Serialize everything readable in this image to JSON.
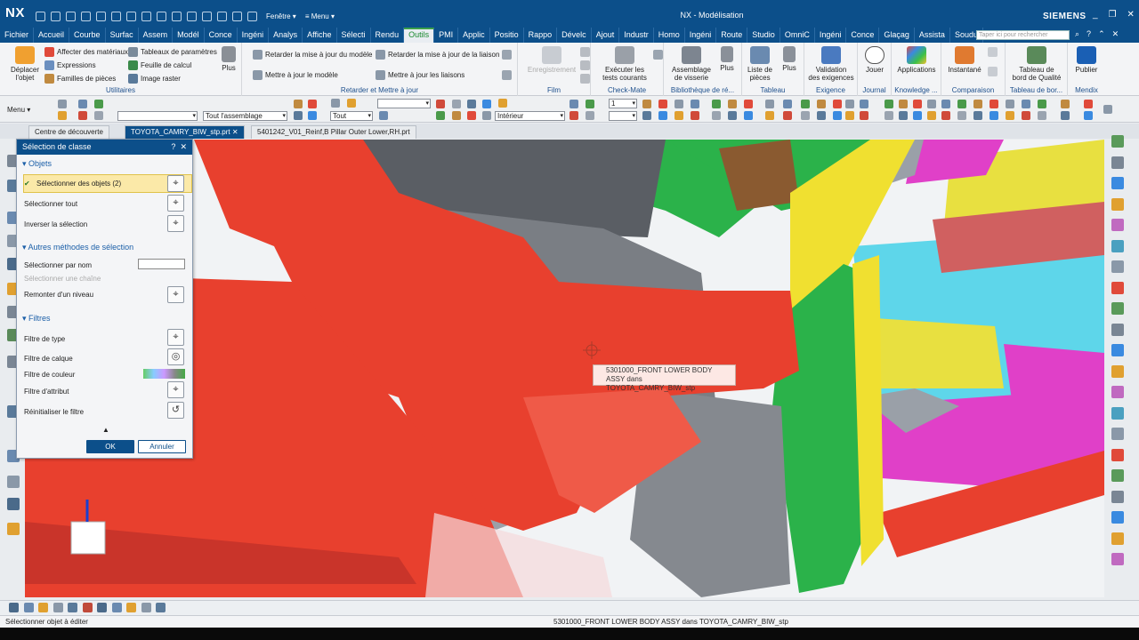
{
  "app": {
    "logo": "NX",
    "window_title": "NX - Modélisation",
    "brand": "SIEMENS",
    "qat_window_menu": "Fenêtre ▾",
    "qat_menu": "≡ Menu ▾",
    "window_controls": [
      "_",
      "❐",
      "✕"
    ]
  },
  "menu_tabs": [
    "Fichier",
    "Accueil",
    "Courbe",
    "Surfac",
    "Assem",
    "Modél",
    "Conce",
    "Ingéni",
    "Analys",
    "Affiche",
    "Sélecti",
    "Rendu",
    "Outils",
    "PMI",
    "Applic",
    "Positio",
    "Rappo",
    "Dévelc",
    "Ajout",
    "Industr",
    "Homo",
    "Ingéni",
    "Route",
    "Studio",
    "OmniC",
    "Ingéni",
    "Conce",
    "Glaçag",
    "Assista",
    "Soudu"
  ],
  "active_tab": "Outils",
  "search": {
    "placeholder": "Taper ici pour rechercher"
  },
  "ribbon": {
    "groups": [
      {
        "label": "Utilitaires",
        "big": "Déplacer\nl'objet",
        "small": [
          "Affecter des matériaux",
          "Expressions",
          "Familles de pièces",
          "Tableaux de paramètres",
          "Feuille de calcul",
          "Image raster"
        ],
        "more": "Plus"
      },
      {
        "label": "Retarder et Mettre à jour",
        "small": [
          "Retarder la mise à jour du modèle",
          "Mettre à jour le modèle",
          "Retarder la mise à jour de la liaison",
          "Mettre à jour les liaisons"
        ]
      },
      {
        "label": "Film",
        "big": "Enregistrement"
      },
      {
        "label": "Check-Mate",
        "big": "Exécuter les\ntests courants"
      },
      {
        "label": "Bibliothèque de ré...",
        "big": "Assemblage\nde visserie",
        "more": "Plus"
      },
      {
        "label": "Tableau",
        "big": "Liste de\npièces",
        "more": "Plus"
      },
      {
        "label": "Exigence",
        "big": "Validation\ndes exigences"
      },
      {
        "label": "Journal",
        "big": "Jouer"
      },
      {
        "label": "Knowledge ...",
        "big": "Applications"
      },
      {
        "label": "Comparaison",
        "big": "Instantané"
      },
      {
        "label": "Tableau de bor...",
        "big": "Tableau de\nbord de Qualité"
      },
      {
        "label": "Mendix",
        "big": "Publier"
      }
    ]
  },
  "toolbar": {
    "menu_label": "Menu ▾",
    "filter_combo": "",
    "scope_combo": "Tout l'assemblage",
    "type_combo": "Tout",
    "display_combo": "Intérieur",
    "layer_combo": "1"
  },
  "doc_tabs": [
    {
      "label": "Centre de découverte"
    },
    {
      "label": "TOYOTA_CAMRY_BIW_stp.prt"
    },
    {
      "label": "5401242_V01_Reinf,B Pillar Outer Lower,RH.prt"
    }
  ],
  "dialog": {
    "title": "Sélection de classe",
    "help": "?",
    "close": "✕",
    "sections": {
      "objets": "Objets",
      "autres": "Autres méthodes de sélection",
      "filtres": "Filtres"
    },
    "rows": {
      "select_objects": "Sélectionner des objets (2)",
      "select_all": "Sélectionner tout",
      "invert": "Inverser la sélection",
      "by_name": "Sélectionner par nom",
      "chain": "Sélectionner une chaîne",
      "up_level": "Remonter d'un niveau",
      "type_filter": "Filtre de type",
      "layer_filter": "Filtre de calque",
      "color_filter": "Filtre de couleur",
      "attr_filter": "Filtre d'attribut",
      "reset_filter": "Réinitialiser le filtre"
    },
    "ok": "OK",
    "cancel": "Annuler"
  },
  "tooltip": {
    "line1": "5301000_FRONT LOWER BODY ASSY dans",
    "line2": "TOYOTA_CAMRY_BIW_stp"
  },
  "status": {
    "left": "Sélectionner objet à éditer",
    "center": "5301000_FRONT LOWER BODY ASSY dans TOYOTA_CAMRY_BIW_stp"
  },
  "colors": {
    "accent": "#0c4f8a",
    "selected_red": "#e8402e",
    "active_tab_green": "#1b8a2f",
    "highlight_yellow": "#fbe9a8"
  }
}
